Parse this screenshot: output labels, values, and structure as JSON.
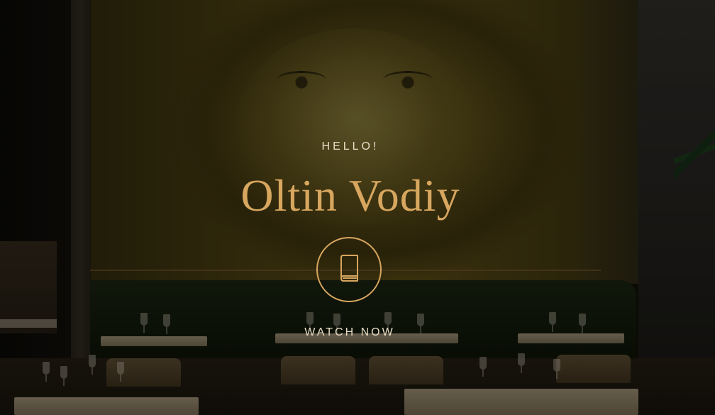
{
  "hero": {
    "eyebrow": "HELLO!",
    "title": "Oltin Vodiy",
    "cta_icon": "book-icon",
    "cta_label": "WATCH NOW"
  },
  "colors": {
    "accent": "#d7a65f",
    "text_light": "#e8dcc6",
    "overlay": "rgba(0,0,0,0.45)"
  }
}
